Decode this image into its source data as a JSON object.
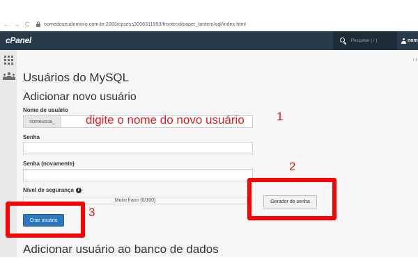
{
  "browser": {
    "url": "nomedoseudominio.com.br:2083/cpsess3008311993/frontend/paper_lantern/sql/index.html",
    "back_glyph": "←",
    "forward_glyph": "→",
    "reload_glyph": "C"
  },
  "header": {
    "logo": "cPanel",
    "search_placeholder": "Pesquisar ( / )",
    "user_name": "nome"
  },
  "main": {
    "top_link": "↑ I",
    "page_title": "Usuários do MySQL",
    "section_title": "Adicionar novo usuário",
    "username_label": "Nome de usuário",
    "username_prefix": "nomeusua_",
    "password_label": "Senha",
    "password2_label": "Senha (novamente)",
    "strength_label": "Nível de segurança",
    "strength_text": "Muito fraco (0/100)",
    "generate_button": "Gerador de senha",
    "create_button": "Criar usuário",
    "bottom_title": "Adicionar usuário ao banco de dados"
  },
  "annotations": {
    "instruction": "digite o nome do novo usuário",
    "step1": "1",
    "step2": "2",
    "step3": "3"
  },
  "colors": {
    "topbar": "#293a4a",
    "annotation_red": "#ff0000",
    "primary_button": "#2e79be"
  }
}
